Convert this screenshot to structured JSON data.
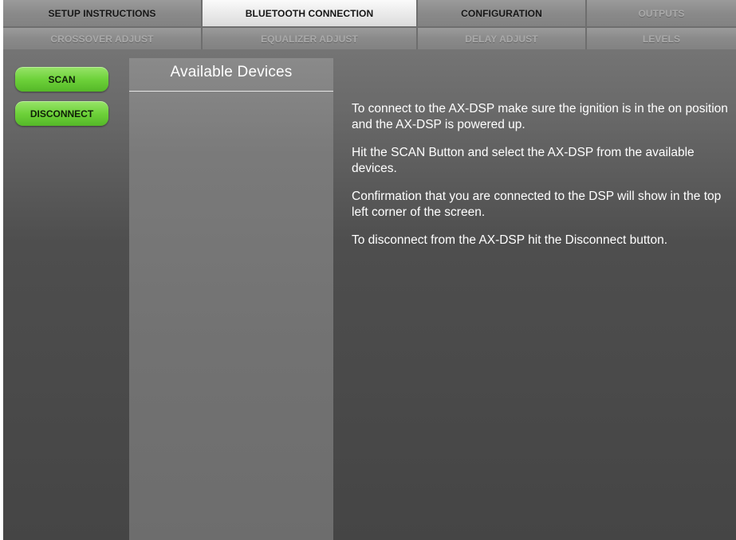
{
  "tabs": {
    "row1": [
      {
        "label": "SETUP INSTRUCTIONS",
        "state": "normal"
      },
      {
        "label": "BLUETOOTH CONNECTION",
        "state": "active"
      },
      {
        "label": "CONFIGURATION",
        "state": "normal"
      },
      {
        "label": "OUTPUTS",
        "state": "disabled"
      }
    ],
    "row2": [
      {
        "label": "CROSSOVER ADJUST",
        "state": "disabled"
      },
      {
        "label": "EQUALIZER ADJUST",
        "state": "disabled"
      },
      {
        "label": "DELAY ADJUST",
        "state": "disabled"
      },
      {
        "label": "LEVELS",
        "state": "disabled"
      }
    ]
  },
  "buttons": {
    "scan": "SCAN",
    "disconnect": "DISCONNECT"
  },
  "devices": {
    "title": "Available Devices",
    "items": []
  },
  "instructions": [
    "To connect to the AX-DSP make sure the ignition is in the on position and the AX-DSP is powered up.",
    "Hit the SCAN Button and select the AX-DSP from the available devices.",
    "Confirmation that you are connected to the DSP will show in the top left corner of the screen.",
    "To disconnect from the AX-DSP hit the Disconnect button."
  ],
  "colors": {
    "button_green": "#6ed23a",
    "active_tab": "#f0f0f0",
    "inactive_tab": "#8c8c8c",
    "disabled_tab_text": "#a9a9a9"
  }
}
